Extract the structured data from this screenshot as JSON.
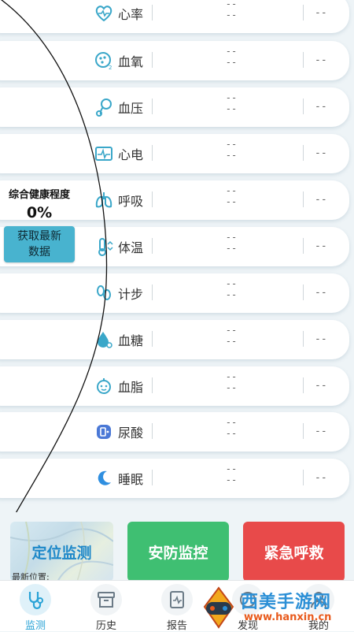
{
  "metrics": [
    {
      "label": "心率",
      "icon": "heart-rate-icon",
      "value_top": "--",
      "value_bottom": "--",
      "value_right": "--"
    },
    {
      "label": "血氧",
      "icon": "blood-oxygen-icon",
      "value_top": "--",
      "value_bottom": "--",
      "value_right": "--"
    },
    {
      "label": "血压",
      "icon": "blood-pressure-icon",
      "value_top": "--",
      "value_bottom": "--",
      "value_right": "--"
    },
    {
      "label": "心电",
      "icon": "ecg-icon",
      "value_top": "--",
      "value_bottom": "--",
      "value_right": "--"
    },
    {
      "label": "呼吸",
      "icon": "lungs-icon",
      "value_top": "--",
      "value_bottom": "--",
      "value_right": "--"
    },
    {
      "label": "体温",
      "icon": "thermometer-icon",
      "value_top": "--",
      "value_bottom": "--",
      "value_right": "--"
    },
    {
      "label": "计步",
      "icon": "footsteps-icon",
      "value_top": "--",
      "value_bottom": "--",
      "value_right": "--"
    },
    {
      "label": "血糖",
      "icon": "blood-sugar-icon",
      "value_top": "--",
      "value_bottom": "--",
      "value_right": "--"
    },
    {
      "label": "血脂",
      "icon": "blood-lipid-icon",
      "value_top": "--",
      "value_bottom": "--",
      "value_right": "--"
    },
    {
      "label": "尿酸",
      "icon": "uric-acid-icon",
      "value_top": "--",
      "value_bottom": "--",
      "value_right": "--"
    },
    {
      "label": "睡眠",
      "icon": "moon-icon",
      "value_top": "--",
      "value_bottom": "--",
      "value_right": "--"
    }
  ],
  "health": {
    "title": "综合健康程度",
    "percent": "0%",
    "refresh_label": "获取最新数据"
  },
  "actions": {
    "location_label": "定位监测",
    "location_sub": "最新位置:",
    "security_label": "安防监控",
    "sos_label": "紧急呼救"
  },
  "tabs": [
    {
      "label": "监测",
      "icon": "stethoscope-icon",
      "active": true
    },
    {
      "label": "历史",
      "icon": "archive-box-icon",
      "active": false
    },
    {
      "label": "报告",
      "icon": "report-icon",
      "active": false
    },
    {
      "label": "发现",
      "icon": "discover-icon",
      "active": false
    },
    {
      "label": "我的",
      "icon": "profile-icon",
      "active": false
    }
  ],
  "watermark": {
    "text": "西美手游网",
    "url": "www.hanxin.cn"
  },
  "colors": {
    "accent": "#2aa3d6",
    "security": "#3fbf72",
    "sos": "#e84a4a",
    "refresh": "#48b3cf"
  }
}
